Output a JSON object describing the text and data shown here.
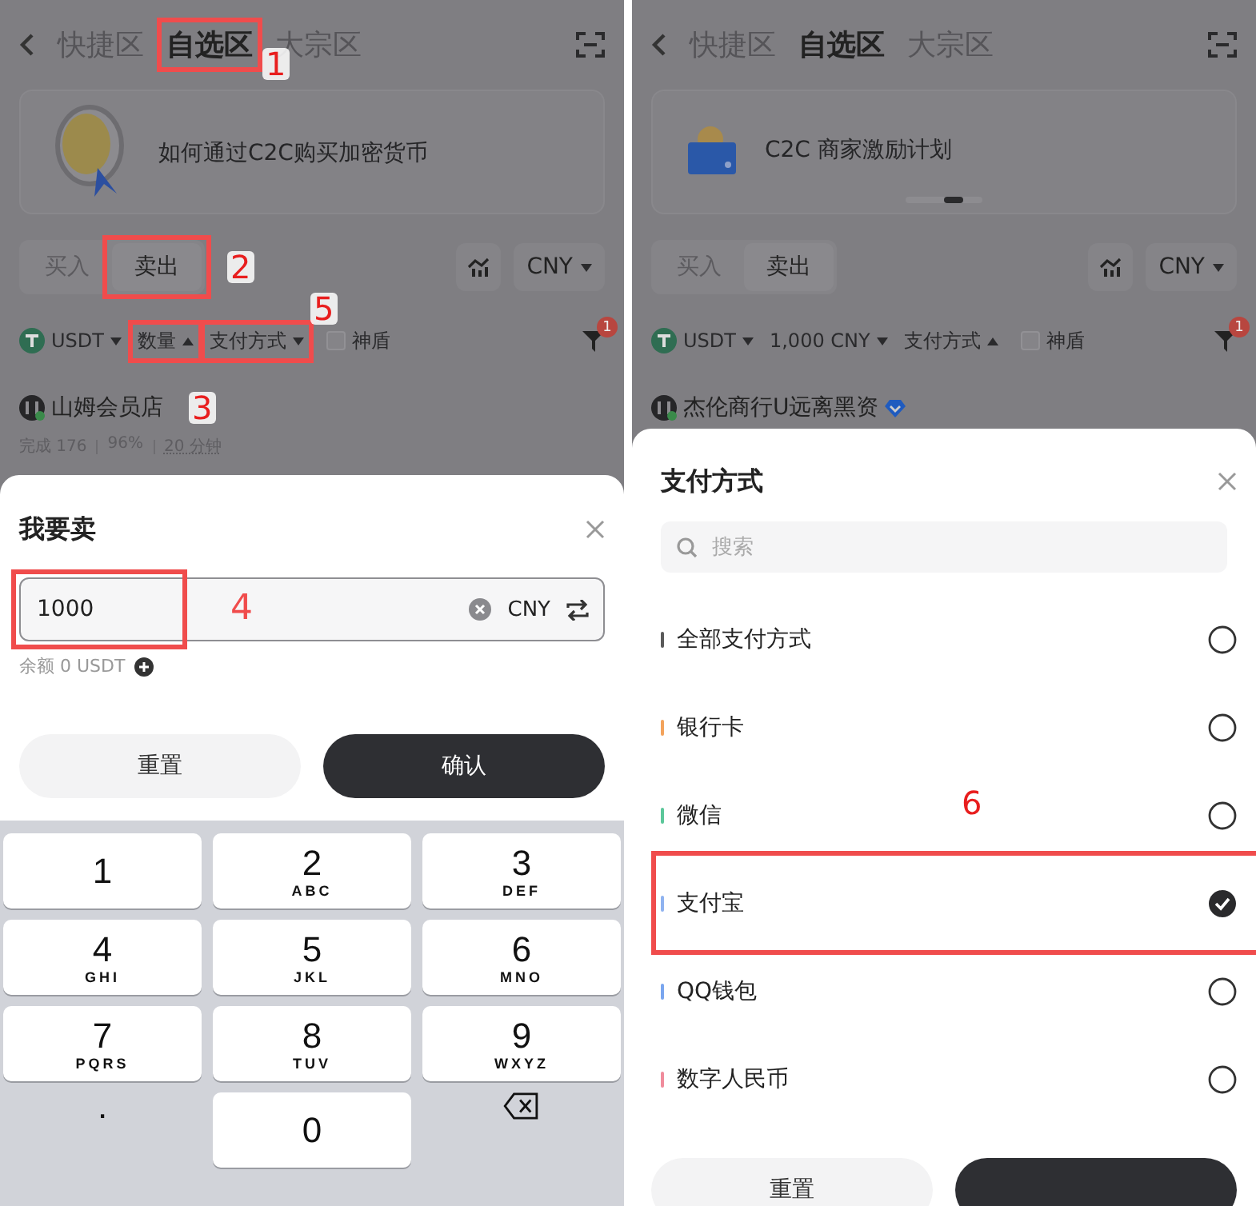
{
  "screens": [
    {
      "header": {
        "tabs": [
          {
            "label": "快捷区",
            "selected": false
          },
          {
            "label": "自选区",
            "selected": true,
            "annotation": {
              "number": "1",
              "boxed": true
            }
          },
          {
            "label": "大宗区",
            "selected": false
          }
        ]
      },
      "banner": {
        "kind": "coin",
        "text": "如何通过C2C购买加密货币"
      },
      "trade_tabs": [
        {
          "label": "买入",
          "selected": false
        },
        {
          "label": "卖出",
          "selected": true,
          "annotation": {
            "number": "2",
            "boxed": true
          }
        }
      ],
      "currency": "CNY",
      "filters": [
        {
          "label": "USDT",
          "kind": "token",
          "expanded": false
        },
        {
          "label": "数量",
          "kind": "plain",
          "expanded": true,
          "annotation": {
            "boxed": true
          }
        },
        {
          "label": "支付方式",
          "kind": "plain",
          "expanded": false,
          "annotation": {
            "number": "5",
            "boxed": true
          }
        }
      ],
      "shield": {
        "label": "神盾",
        "checked": false
      },
      "filter_badge": "1",
      "merchant": {
        "name": "山姆会员店",
        "verified": false,
        "annotation": {
          "number": "3",
          "boxed": false
        },
        "stats": [
          "完成 176",
          "96%",
          "20 分钟"
        ]
      },
      "sheet": {
        "kind": "amount",
        "title": "我要卖",
        "value": "1000",
        "annotation": {
          "number": "4",
          "boxed": true
        },
        "currency": "CNY",
        "balance": "余额 0 USDT",
        "buttons": [
          {
            "kind": "secondary",
            "label": "重置"
          },
          {
            "kind": "primary",
            "label": "确认"
          }
        ],
        "keys": [
          {
            "kind": "key",
            "label": "1"
          },
          {
            "kind": "key",
            "label": "2",
            "letters": "ABC"
          },
          {
            "kind": "key",
            "label": "3",
            "letters": "DEF"
          },
          {
            "kind": "key",
            "label": "4",
            "letters": "GHI"
          },
          {
            "kind": "key",
            "label": "5",
            "letters": "JKL"
          },
          {
            "kind": "key",
            "label": "6",
            "letters": "MNO"
          },
          {
            "kind": "key",
            "label": "7",
            "letters": "PQRS"
          },
          {
            "kind": "key",
            "label": "8",
            "letters": "TUV"
          },
          {
            "kind": "key",
            "label": "9",
            "letters": "WXYZ"
          },
          {
            "kind": "plain",
            "label": "."
          },
          {
            "kind": "key",
            "label": "0"
          },
          {
            "kind": "backspace"
          }
        ]
      }
    },
    {
      "header": {
        "tabs": [
          {
            "label": "快捷区",
            "selected": false
          },
          {
            "label": "自选区",
            "selected": true
          },
          {
            "label": "大宗区",
            "selected": false
          }
        ]
      },
      "banner": {
        "kind": "wallet",
        "text": "C2C 商家激励计划"
      },
      "trade_tabs": [
        {
          "label": "买入",
          "selected": false
        },
        {
          "label": "卖出",
          "selected": true
        }
      ],
      "currency": "CNY",
      "filters": [
        {
          "label": "USDT",
          "kind": "token",
          "expanded": false
        },
        {
          "label": "1,000 CNY",
          "kind": "plain",
          "expanded": false
        },
        {
          "label": "支付方式",
          "kind": "plain",
          "expanded": true
        }
      ],
      "shield": {
        "label": "神盾",
        "checked": false
      },
      "filter_badge": "1",
      "merchant": {
        "name": "杰伦商行U远离黑资",
        "verified": true
      },
      "sheet": {
        "kind": "payment",
        "title": "支付方式",
        "search_placeholder": "搜索",
        "options": [
          {
            "label": "全部支付方式",
            "color": "#5a5a5a",
            "selected": false
          },
          {
            "label": "银行卡",
            "color": "#f3a35c",
            "selected": false
          },
          {
            "label": "微信",
            "color": "#5cc79a",
            "selected": false
          },
          {
            "label": "支付宝",
            "color": "#8fb3f0",
            "selected": true,
            "annotation": {
              "number": "6",
              "boxed": true
            }
          },
          {
            "label": "QQ钱包",
            "color": "#7aa6ef",
            "selected": false
          },
          {
            "label": "数字人民币",
            "color": "#f08c9c",
            "selected": false
          }
        ],
        "buttons": [
          {
            "kind": "secondary",
            "label": "重置"
          },
          {
            "kind": "primary"
          }
        ]
      }
    }
  ]
}
